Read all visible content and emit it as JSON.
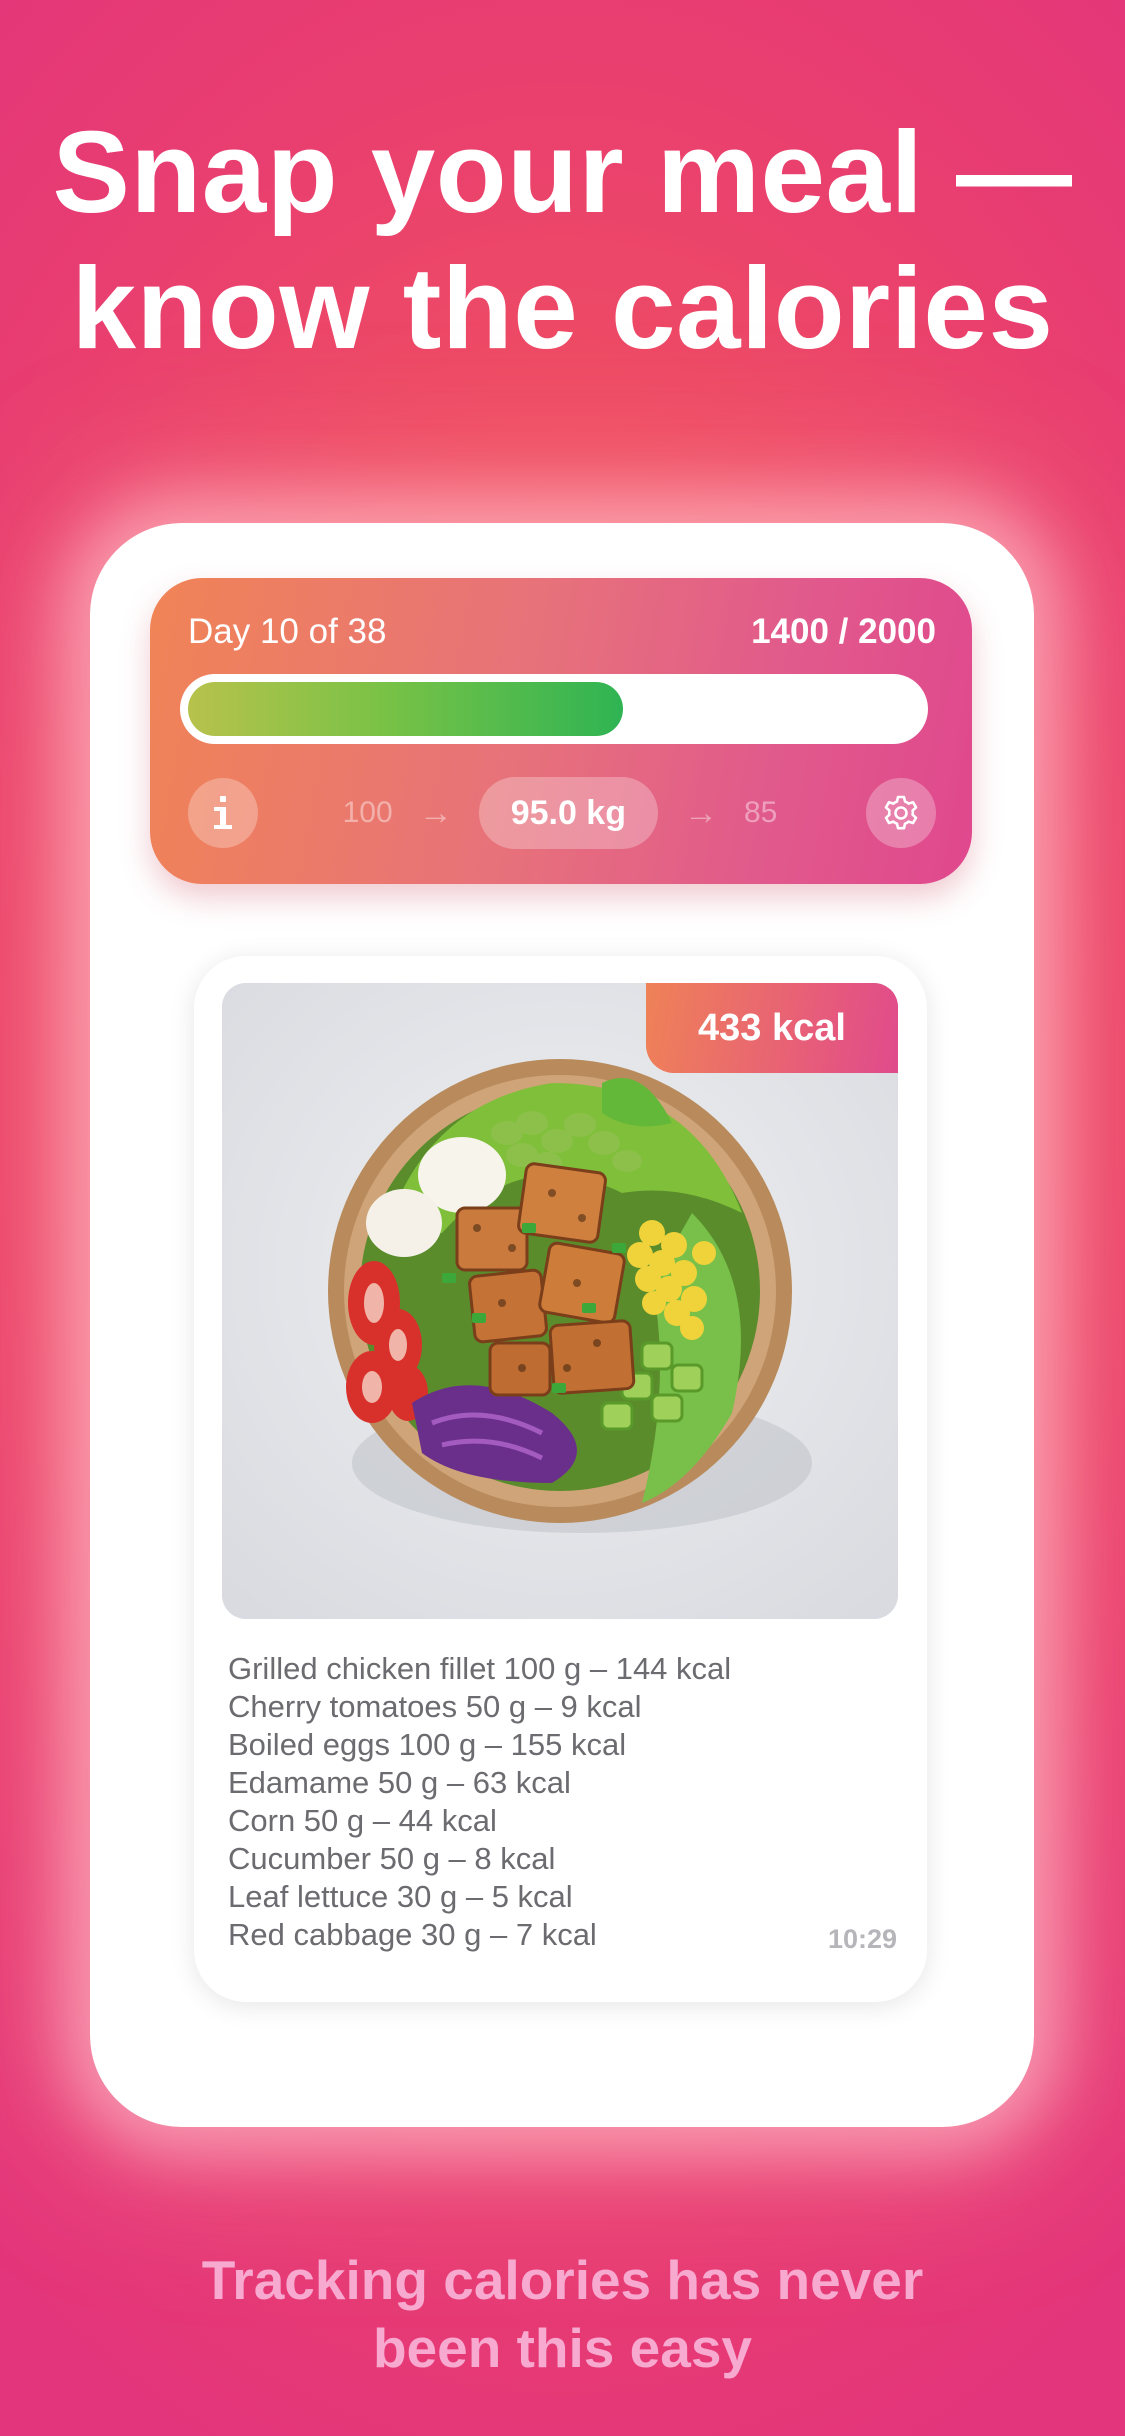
{
  "headline": {
    "line1": "Snap your meal —",
    "line2": "know the calories"
  },
  "progress": {
    "day_label": "Day 10 of 38",
    "calories_label": "1400 / 2000",
    "calories_consumed": 1400,
    "calories_goal": 2000,
    "start_weight": "100",
    "current_weight": "95.0 kg",
    "target_weight": "85",
    "arrow": "→",
    "info_icon": "info-icon",
    "settings_icon": "gear-icon"
  },
  "meal": {
    "kcal_badge": "433 kcal",
    "photo": "salad-bowl-photo",
    "ingredients": [
      "Grilled chicken fillet 100 g – 144 kcal",
      "Cherry tomatoes 50 g – 9 kcal",
      "Boiled eggs 100 g – 155 kcal",
      "Edamame 50 g – 63 kcal",
      "Corn 50 g – 44 kcal",
      "Cucumber 50 g – 8 kcal",
      "Leaf lettuce 30 g – 5 kcal",
      "Red cabbage 30 g – 7 kcal"
    ],
    "time": "10:29"
  },
  "tagline": {
    "line1": "Tracking calories has never",
    "line2": "been this easy"
  },
  "colors": {
    "background": "#e93f6f",
    "accent_orange": "#f08456",
    "accent_pink": "#e0488d",
    "progress_green": "#2fb453",
    "tagline_pink": "#f7a9cf"
  }
}
